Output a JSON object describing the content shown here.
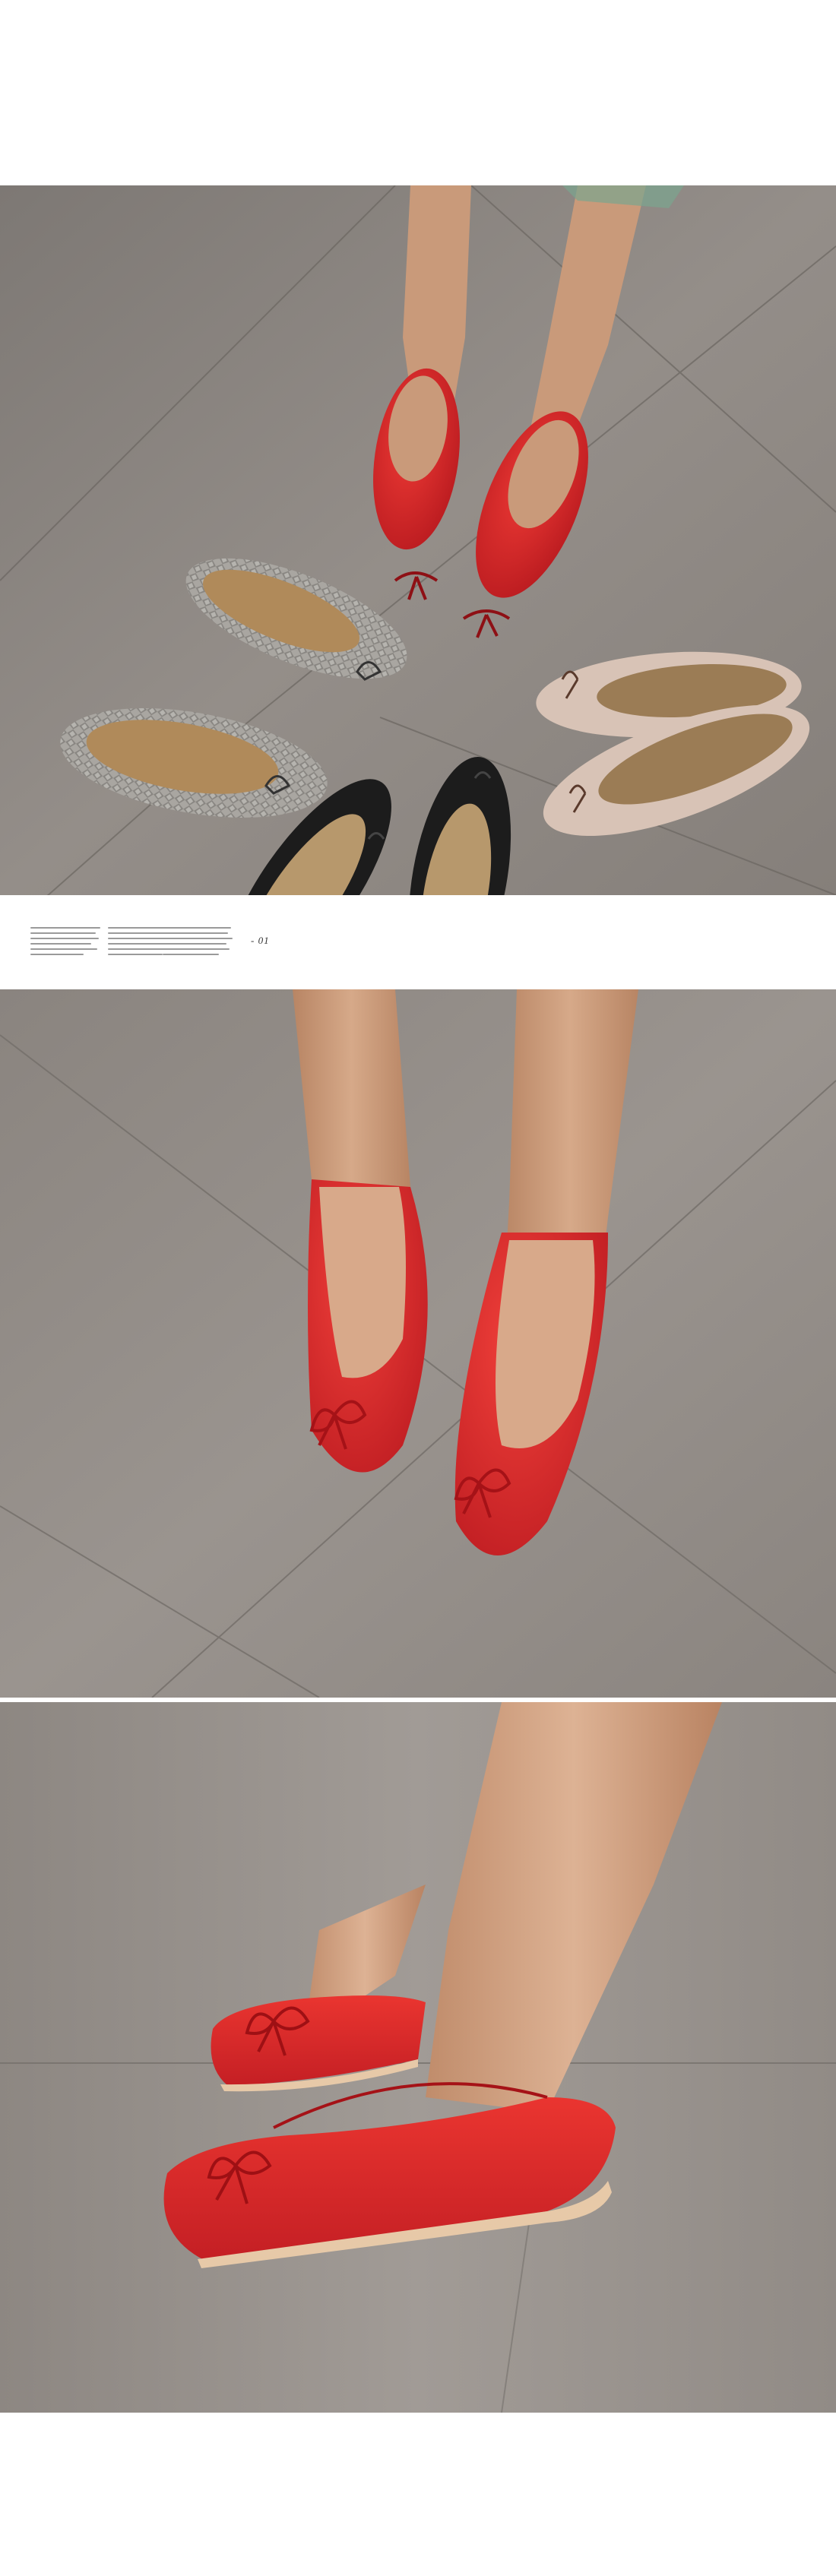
{
  "caption": {
    "number": "- 01"
  },
  "colors": {
    "background": "#ffffff",
    "floor": "#8c8681",
    "red_shoe": "#d9272b",
    "black_shoe": "#1c1c1c",
    "beige_shoe": "#d8c3b6",
    "snake_shoe": "#9c9a96",
    "skin": "#c99a7a"
  }
}
